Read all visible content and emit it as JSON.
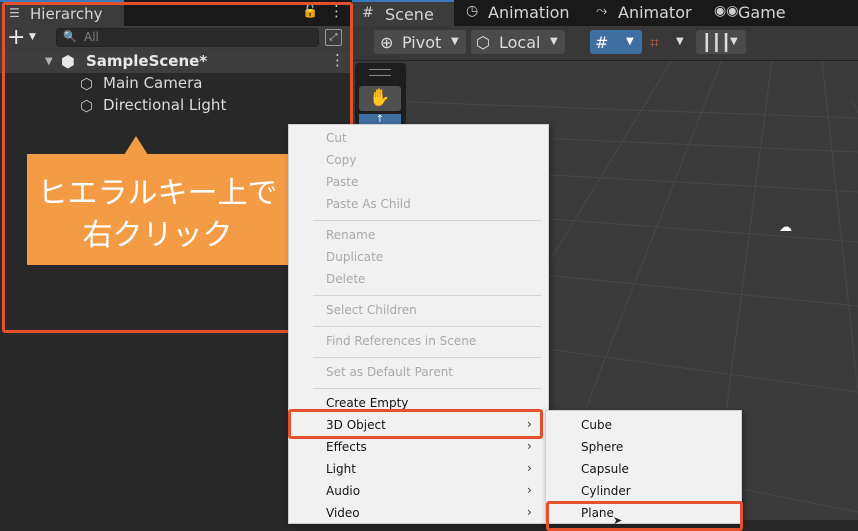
{
  "hierarchy": {
    "tab_label": "Hierarchy",
    "add_label": "+",
    "search": {
      "value": "All"
    },
    "scene_name": "SampleScene*",
    "objects": [
      "Main Camera",
      "Directional Light"
    ]
  },
  "callout": {
    "line1": "ヒエラルキー上で",
    "line2": "右クリック"
  },
  "scene_view": {
    "tabs": [
      {
        "label": "Scene",
        "icon": "grid-hash-icon"
      },
      {
        "label": "Animation",
        "icon": "clock-icon"
      },
      {
        "label": "Animator",
        "icon": "animator-icon"
      },
      {
        "label": "Game",
        "icon": "gamepad-icon"
      }
    ],
    "toolbar": {
      "pivot_label": "Pivot",
      "local_label": "Local"
    }
  },
  "context_menu": {
    "items": [
      {
        "label": "Cut",
        "disabled": true
      },
      {
        "label": "Copy",
        "disabled": true
      },
      {
        "label": "Paste",
        "disabled": true
      },
      {
        "label": "Paste As Child",
        "disabled": true
      },
      {
        "label": "Rename",
        "disabled": true
      },
      {
        "label": "Duplicate",
        "disabled": true
      },
      {
        "label": "Delete",
        "disabled": true
      },
      {
        "label": "Select Children",
        "disabled": true
      },
      {
        "label": "Find References in Scene",
        "disabled": true
      },
      {
        "label": "Set as Default Parent",
        "disabled": true
      },
      {
        "label": "Create Empty",
        "disabled": false
      },
      {
        "label": "3D Object",
        "disabled": false
      },
      {
        "label": "Effects",
        "disabled": false
      },
      {
        "label": "Light",
        "disabled": false
      },
      {
        "label": "Audio",
        "disabled": false
      },
      {
        "label": "Video",
        "disabled": false
      }
    ],
    "submenu_arrow": "›"
  },
  "submenu_3d": {
    "items": [
      "Cube",
      "Sphere",
      "Capsule",
      "Cylinder",
      "Plane"
    ]
  },
  "colors": {
    "highlight": "#e4512c",
    "callout": "#f49b45",
    "accent": "#3a79bb"
  }
}
